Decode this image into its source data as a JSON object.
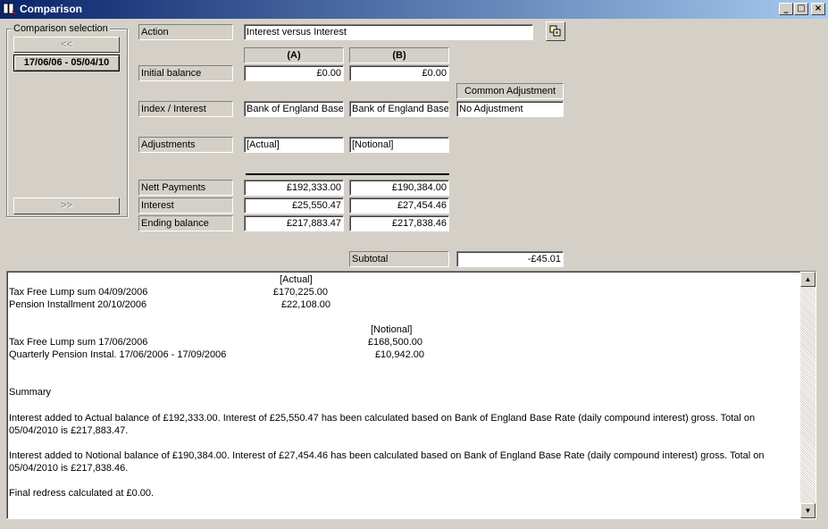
{
  "window": {
    "title": "Comparison",
    "minimize_glyph": "_",
    "maximize_glyph": "□",
    "close_glyph": "×"
  },
  "selection": {
    "group_label": "Comparison selection",
    "prev_label": "<<",
    "period_label": "17/06/06 - 05/04/10",
    "next_label": ">>"
  },
  "action": {
    "label": "Action",
    "value": "Interest versus Interest"
  },
  "columns": {
    "a_header": "(A)",
    "b_header": "(B)",
    "common_header": "Common Adjustment"
  },
  "initial_balance": {
    "label": "Initial balance",
    "a": "£0.00",
    "b": "£0.00"
  },
  "index_interest": {
    "label": "Index / Interest",
    "a": "Bank of England Base",
    "b": "Bank of England Base",
    "common": "No Adjustment"
  },
  "adjustments": {
    "label": "Adjustments",
    "a": "[Actual]",
    "b": "[Notional]"
  },
  "nett_payments": {
    "label": "Nett Payments",
    "a": "£192,333.00",
    "b": "£190,384.00"
  },
  "interest": {
    "label": "Interest",
    "a": "£25,550.47",
    "b": "£27,454.46"
  },
  "ending_balance": {
    "label": "Ending balance",
    "a": "£217,883.47",
    "b": "£217,838.46"
  },
  "subtotal": {
    "label": "Subtotal",
    "value": "-£45.01"
  },
  "report": {
    "actual_heading": "[Actual]",
    "actual_rows": [
      {
        "desc": "Tax Free Lump sum 04/09/2006",
        "amount": "£170,225.00"
      },
      {
        "desc": "Pension Installment 20/10/2006",
        "amount": "£22,108.00"
      }
    ],
    "notional_heading": "[Notional]",
    "notional_rows": [
      {
        "desc": "Tax Free Lump sum 17/06/2006",
        "amount": "£168,500.00"
      },
      {
        "desc": "Quarterly Pension Instal. 17/06/2006 - 17/09/2006",
        "amount": "£10,942.00"
      }
    ],
    "summary_heading": "Summary",
    "para_actual": "Interest added to Actual balance of £192,333.00. Interest of £25,550.47 has been calculated based on Bank of England Base Rate (daily compound interest) gross. Total on 05/04/2010 is £217,883.47.",
    "para_notional": "Interest added to Notional balance of £190,384.00. Interest of £27,454.46 has been calculated based on Bank of England Base Rate (daily compound interest) gross. Total on 05/04/2010 is £217,838.46.",
    "final": "Final redress calculated at £0.00."
  }
}
